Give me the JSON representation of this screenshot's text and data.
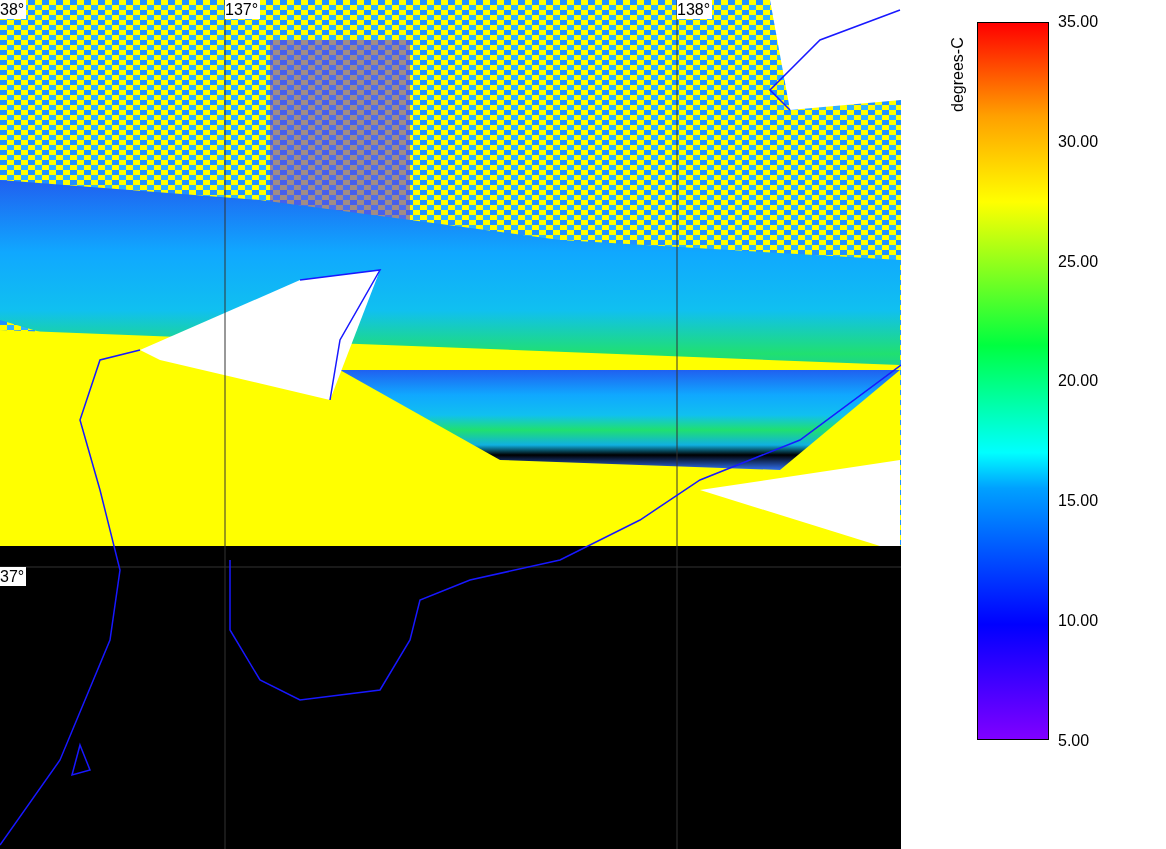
{
  "map": {
    "latitude_labels": [
      "38°",
      "37°"
    ],
    "longitude_labels": [
      "137°",
      "138°"
    ]
  },
  "legend": {
    "unit": "degrees-C",
    "ticks": [
      "35.00",
      "30.00",
      "25.00",
      "20.00",
      "15.00",
      "10.00",
      "5.00"
    ]
  }
}
